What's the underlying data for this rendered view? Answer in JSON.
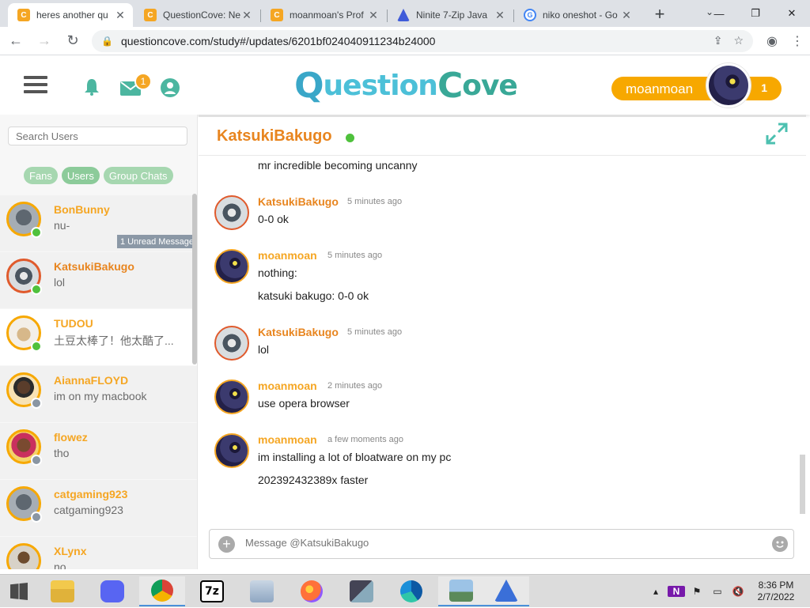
{
  "browser": {
    "tabs": [
      {
        "title": "heres another qu",
        "favicon": "questioncove-icon",
        "active": true
      },
      {
        "title": "QuestionCove: Ne",
        "favicon": "questioncove-icon",
        "active": false
      },
      {
        "title": "moanmoan's Prof",
        "favicon": "questioncove-icon",
        "active": false
      },
      {
        "title": "Ninite 7-Zip Java",
        "favicon": "ninite-icon",
        "active": false
      },
      {
        "title": "niko oneshot - Go",
        "favicon": "google-icon",
        "active": false
      }
    ],
    "url": "questioncove.com/study#/updates/6201bf024040911234b24000"
  },
  "header": {
    "logo_text_q": "Q",
    "logo_text_mid": "uestion",
    "logo_text_c": "C",
    "logo_text_end": "ove",
    "mail_badge": "1",
    "username": "moanmoan",
    "user_count": "1"
  },
  "sidebar": {
    "search_placeholder": "Search Users",
    "filters": [
      "Fans",
      "Users",
      "Group Chats"
    ],
    "users": [
      {
        "name": "BonBunny",
        "message": "nu-",
        "status": "online",
        "unread": "1 Unread Message"
      },
      {
        "name": "KatsukiBakugo",
        "message": "lol",
        "status": "online"
      },
      {
        "name": "TUDOU",
        "message": "土豆太棒了！他太酷了...",
        "status": "online"
      },
      {
        "name": "AiannaFLOYD",
        "message": "im on my macbook",
        "status": "offline"
      },
      {
        "name": "flowez",
        "message": "tho",
        "status": "offline"
      },
      {
        "name": "catgaming923",
        "message": "catgaming923",
        "status": "offline"
      },
      {
        "name": "XLynx",
        "message": "no",
        "status": "offline"
      }
    ]
  },
  "chat": {
    "title": "KatsukiBakugo",
    "top_line": "mr incredible becoming uncanny",
    "messages": [
      {
        "author": "KatsukiBakugo",
        "time": "5 minutes ago",
        "lines": [
          "0-0 ok"
        ]
      },
      {
        "author": "moanmoan",
        "time": "5 minutes ago",
        "lines": [
          "nothing:",
          "katsuki bakugo: 0-0 ok"
        ]
      },
      {
        "author": "KatsukiBakugo",
        "time": "5 minutes ago",
        "lines": [
          "lol"
        ]
      },
      {
        "author": "moanmoan",
        "time": "2 minutes ago",
        "lines": [
          "use opera browser"
        ]
      },
      {
        "author": "moanmoan",
        "time": "a few moments ago",
        "lines": [
          "im installing a lot of bloatware on my pc",
          "202392432389x faster"
        ]
      }
    ],
    "composer_placeholder": "Message @KatsukiBakugo"
  },
  "taskbar": {
    "time": "8:36 PM",
    "date": "2/7/2022",
    "apps": [
      "file-explorer-icon",
      "discord-icon",
      "chrome-icon",
      "7zip-icon",
      "photos-icon",
      "firefox-icon",
      "app-icon",
      "edge-icon",
      "landscape-icon",
      "app-blue-icon"
    ]
  }
}
